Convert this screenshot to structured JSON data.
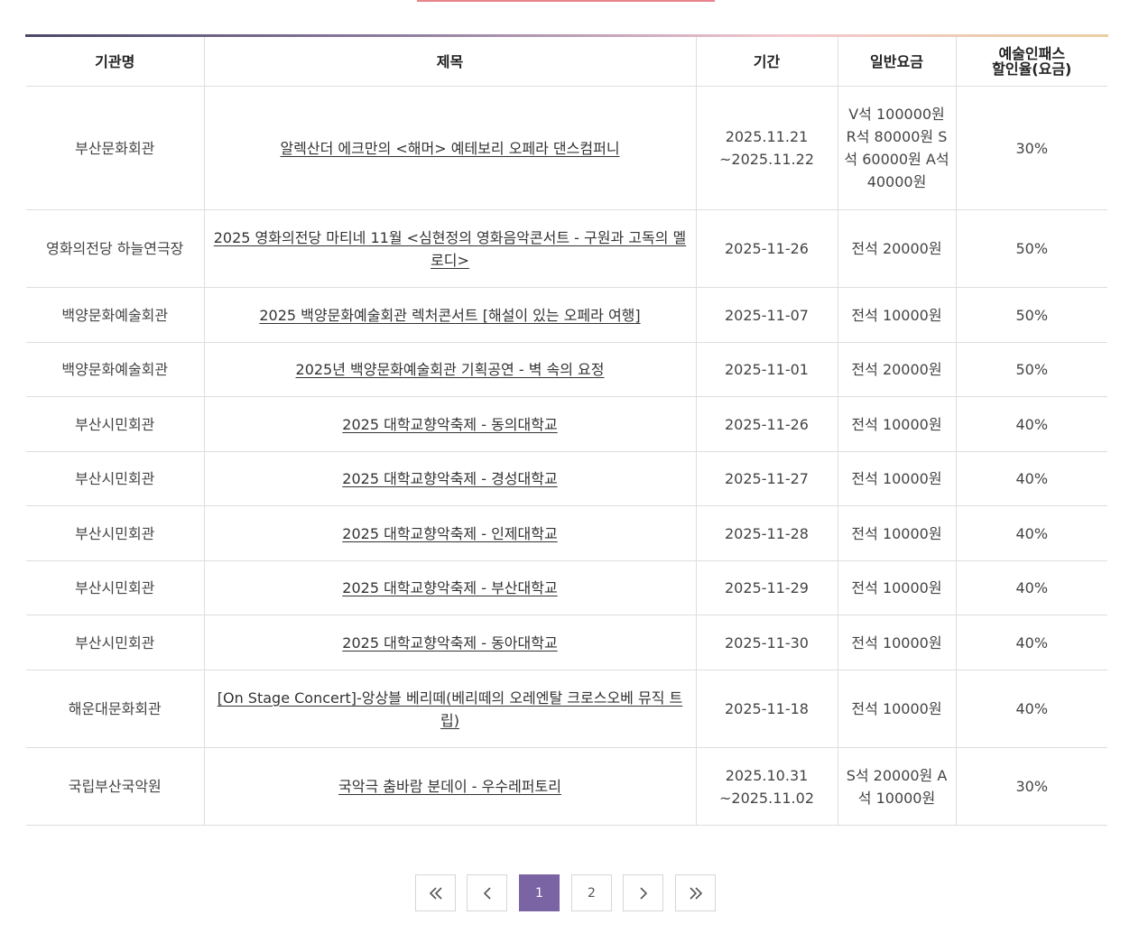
{
  "headers": {
    "org": "기관명",
    "title": "제목",
    "period": "기간",
    "price": "일반요금",
    "discount_l1": "예술인패스",
    "discount_l2": "할인율(요금)"
  },
  "rows": [
    {
      "org": "부산문화회관",
      "title": "알렉산더 에크만의 <해머> 예테보리 오페라 댄스컴퍼니",
      "period": "2025.11.21 ~2025.11.22",
      "price": "V석 100000원 R석 80000원 S석 60000원 A석 40000원",
      "discount": "30%"
    },
    {
      "org": "영화의전당 하늘연극장",
      "title": "2025 영화의전당 마티네 11월 <심현정의 영화음악콘서트 - 구원과 고독의 멜로디>",
      "period": "2025-11-26",
      "price": "전석 20000원",
      "discount": "50%"
    },
    {
      "org": "백양문화예술회관",
      "title": "2025 백양문화예술회관 렉처콘서트 [해설이 있는 오페라 여행]",
      "period": "2025-11-07",
      "price": "전석 10000원",
      "discount": "50%"
    },
    {
      "org": "백양문화예술회관",
      "title": "2025년 백양문화예술회관 기획공연 - 벽 속의 요정",
      "period": "2025-11-01",
      "price": "전석 20000원",
      "discount": "50%"
    },
    {
      "org": "부산시민회관",
      "title": "2025 대학교향악축제 - 동의대학교",
      "period": "2025-11-26",
      "price": "전석 10000원",
      "discount": "40%"
    },
    {
      "org": "부산시민회관",
      "title": "2025 대학교향악축제 - 경성대학교",
      "period": "2025-11-27",
      "price": "전석 10000원",
      "discount": "40%"
    },
    {
      "org": "부산시민회관",
      "title": "2025 대학교향악축제 - 인제대학교",
      "period": "2025-11-28",
      "price": "전석 10000원",
      "discount": "40%"
    },
    {
      "org": "부산시민회관",
      "title": "2025 대학교향악축제 - 부산대학교",
      "period": "2025-11-29",
      "price": "전석 10000원",
      "discount": "40%"
    },
    {
      "org": "부산시민회관",
      "title": "2025 대학교향악축제 - 동아대학교",
      "period": "2025-11-30",
      "price": "전석 10000원",
      "discount": "40%"
    },
    {
      "org": "해운대문화회관",
      "title": "[On Stage Concert]-앙상블 베리떼(베리떼의 오레엔탈 크로스오베 뮤직 트립)",
      "period": "2025-11-18",
      "price": "전석 10000원",
      "discount": "40%"
    },
    {
      "org": "국립부산국악원",
      "title": "국악극 춤바람 분데이 - 우수레퍼토리",
      "period": "2025.10.31 ~2025.11.02",
      "price": "S석 20000원 A석 10000원",
      "discount": "30%"
    }
  ],
  "pagination": {
    "first_icon": "double-chevron-left-icon",
    "prev_icon": "chevron-left-icon",
    "pages": [
      "1",
      "2"
    ],
    "current": "1",
    "next_icon": "chevron-right-icon",
    "last_icon": "double-chevron-right-icon"
  },
  "colors": {
    "accent": "#7b64a3",
    "top_line": "#e8848c"
  }
}
